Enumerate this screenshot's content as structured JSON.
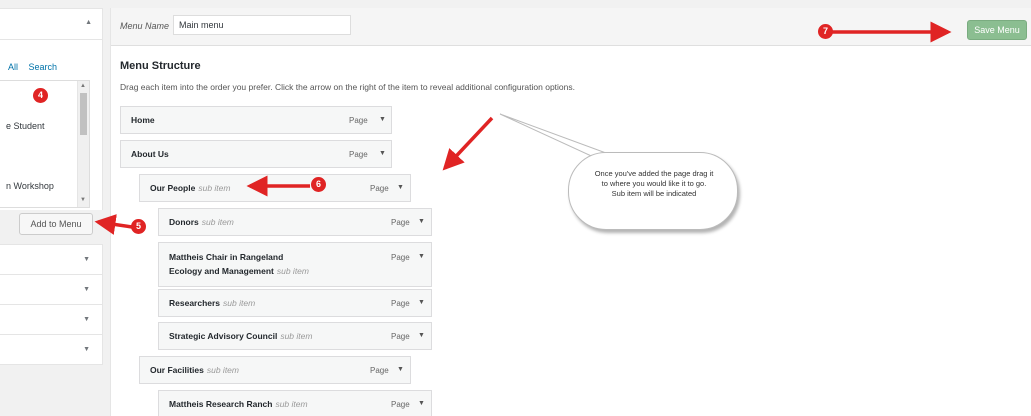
{
  "left_panel": {
    "tabs": [
      "All",
      "Search"
    ],
    "list_items": [
      "e Student",
      "n Workshop"
    ],
    "add_button_label": "Add to Menu"
  },
  "header": {
    "menu_name_label": "Menu Name",
    "menu_name_value": "Main menu",
    "save_button_label": "Save Menu"
  },
  "menu_structure": {
    "title": "Menu Structure",
    "instructions": "Drag each item into the order you prefer. Click the arrow on the right of the item to reveal additional configuration options.",
    "items": [
      {
        "title": "Home",
        "sub": "",
        "type": "Page"
      },
      {
        "title": "About Us",
        "sub": "",
        "type": "Page"
      },
      {
        "title": "Our People",
        "sub": "sub item",
        "type": "Page"
      },
      {
        "title": "Donors",
        "sub": "sub item",
        "type": "Page"
      },
      {
        "title": "Mattheis Chair in Rangeland",
        "title2": "Ecology and Management",
        "sub": "sub item",
        "type": "Page"
      },
      {
        "title": "Researchers",
        "sub": "sub item",
        "type": "Page"
      },
      {
        "title": "Strategic Advisory Council",
        "sub": "sub item",
        "type": "Page"
      },
      {
        "title": "Our Facilities",
        "sub": "sub item",
        "type": "Page"
      },
      {
        "title": "Mattheis Research Ranch",
        "sub": "sub item",
        "type": "Page"
      }
    ]
  },
  "annotations": {
    "badges": [
      "4",
      "5",
      "6",
      "7"
    ],
    "callout_text": "Once you've added the page drag it to where you would like it to go. Sub item will be indicated",
    "arrow_color": "#e02424"
  },
  "icons": [
    "chevron-up-icon",
    "chevron-down-icon",
    "red-arrow-icon"
  ],
  "colors": {
    "link": "#0073aa",
    "save_button": "#8bbe91",
    "badge": "#e02424"
  }
}
